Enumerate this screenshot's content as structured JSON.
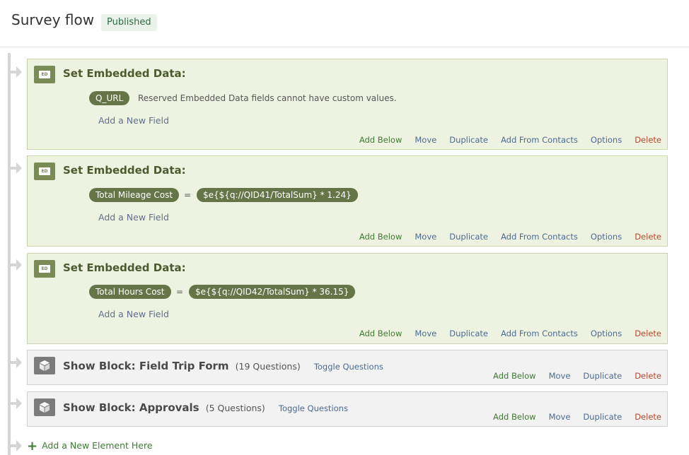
{
  "header": {
    "title": "Survey flow",
    "status": "Published"
  },
  "ed_icon_text": "ED",
  "embedded_blocks": [
    {
      "title": "Set Embedded Data:",
      "field": "Q_URL",
      "message": "Reserved Embedded Data fields cannot have custom values.",
      "add_field": "Add a New Field"
    },
    {
      "title": "Set Embedded Data:",
      "field": "Total Mileage Cost",
      "equals": "=",
      "value": "$e{${q://QID41/TotalSum} * 1.24}",
      "add_field": "Add a New Field"
    },
    {
      "title": "Set Embedded Data:",
      "field": "Total Hours Cost",
      "equals": "=",
      "value": "$e{${q://QID42/TotalSum} * 36.15}",
      "add_field": "Add a New Field"
    }
  ],
  "ed_actions": [
    "Add Below",
    "Move",
    "Duplicate",
    "Add From Contacts",
    "Options",
    "Delete"
  ],
  "show_blocks": [
    {
      "label": "Show Block: Field Trip Form",
      "count": "(19 Questions)",
      "toggle": "Toggle Questions"
    },
    {
      "label": "Show Block: Approvals",
      "count": "(5 Questions)",
      "toggle": "Toggle Questions"
    }
  ],
  "sb_actions": [
    "Add Below",
    "Move",
    "Duplicate",
    "Delete"
  ],
  "footer": {
    "plus": "+",
    "add_element": "Add a New Element Here"
  },
  "colors": {
    "embedded_bg": "#eef3e1",
    "pill": "#667547",
    "link_blue": "#4b6a93",
    "link_green": "#3f7a34",
    "link_red": "#b8472c"
  }
}
